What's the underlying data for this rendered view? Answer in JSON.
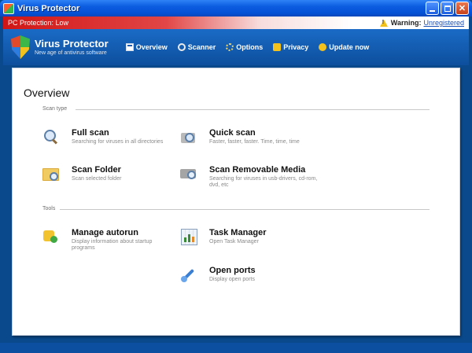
{
  "window": {
    "title": "Virus Protector",
    "buttons": {
      "minimize": "minimize",
      "maximize": "maximize",
      "close": "✕"
    }
  },
  "statusbar": {
    "protection": "PC Protection: Low",
    "warning_label": "Warning:",
    "warning_link": "Unregistered"
  },
  "brand": {
    "name": "Virus Protector",
    "tagline": "New age of antivirus software"
  },
  "nav": [
    {
      "label": "Overview",
      "icon": "overview-icon"
    },
    {
      "label": "Scanner",
      "icon": "scanner-icon"
    },
    {
      "label": "Options",
      "icon": "options-icon"
    },
    {
      "label": "Privacy",
      "icon": "lock-icon"
    },
    {
      "label": "Update now",
      "icon": "update-icon"
    }
  ],
  "main": {
    "title": "Overview",
    "sections": [
      {
        "label": "Scan type",
        "items": [
          {
            "title": "Full scan",
            "desc": "Searching for viruses in all directories",
            "icon": "magnifier-icon"
          },
          {
            "title": "Quick scan",
            "desc": "Faster, faster, faster. Time, time, time",
            "icon": "quick-scan-icon"
          },
          {
            "title": "Scan Folder",
            "desc": "Scan selected folder",
            "icon": "folder-scan-icon"
          },
          {
            "title": "Scan Removable Media",
            "desc": "Searching for viruses in usb-drivers, cd-rom, dvd, etc",
            "icon": "removable-media-icon"
          }
        ]
      },
      {
        "label": "Tools",
        "items": [
          {
            "title": "Manage autorun",
            "desc": "Display information about startup programs",
            "icon": "puzzle-icon"
          },
          {
            "title": "Task Manager",
            "desc": "Open Task Manager",
            "icon": "task-manager-icon"
          },
          {
            "title": "Open ports",
            "desc": "Display open ports",
            "icon": "ports-icon"
          }
        ]
      }
    ]
  },
  "colors": {
    "titlebar": "#0c5ce0",
    "header": "#1a6bc6",
    "status_red": "#d01616",
    "panel_bg": "#ffffff"
  }
}
